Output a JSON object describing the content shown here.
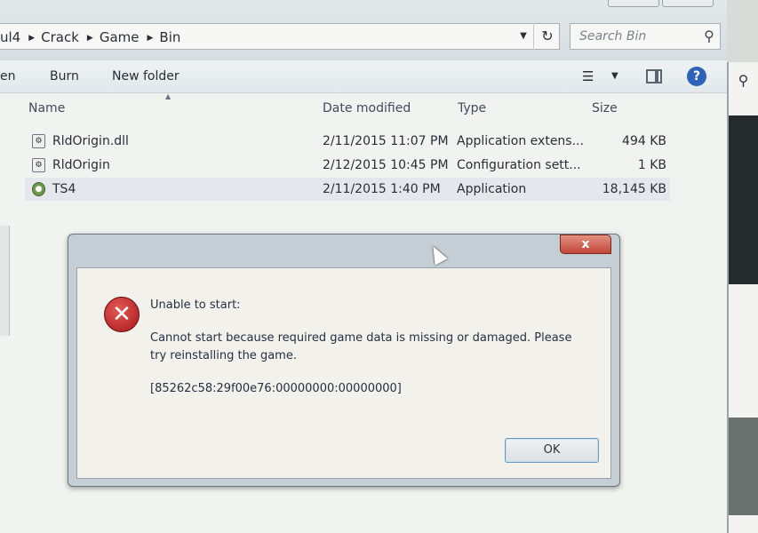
{
  "addressbar": {
    "crumbs": [
      "ul4",
      "Crack",
      "Game",
      "Bin"
    ]
  },
  "search": {
    "placeholder": "Search Bin"
  },
  "toolbar": {
    "open_label": "en",
    "burn_label": "Burn",
    "new_folder_label": "New folder",
    "help_label": "?"
  },
  "columns": {
    "name": "Name",
    "date": "Date modified",
    "type": "Type",
    "size": "Size"
  },
  "files": [
    {
      "name": "RldOrigin.dll",
      "date": "2/11/2015 11:07 PM",
      "type": "Application extens...",
      "size": "494 KB",
      "icon": "dll-file-icon"
    },
    {
      "name": "RldOrigin",
      "date": "2/12/2015 10:45 PM",
      "type": "Configuration sett...",
      "size": "1 KB",
      "icon": "config-file-icon"
    },
    {
      "name": "TS4",
      "date": "2/11/2015 1:40 PM",
      "type": "Application",
      "size": "18,145 KB",
      "icon": "application-icon"
    }
  ],
  "dialog": {
    "close_label": "x",
    "heading": "Unable to start:",
    "message_line1": "Cannot start because required game data is missing or damaged. Please",
    "message_line2": "try reinstalling the game.",
    "code": "[85262c58:29f00e76:00000000:00000000]",
    "ok_label": "OK",
    "icon": "error-icon"
  },
  "colors": {
    "error_red": "#c0262a",
    "close_red": "#c2473a",
    "help_blue": "#2d63b8"
  }
}
